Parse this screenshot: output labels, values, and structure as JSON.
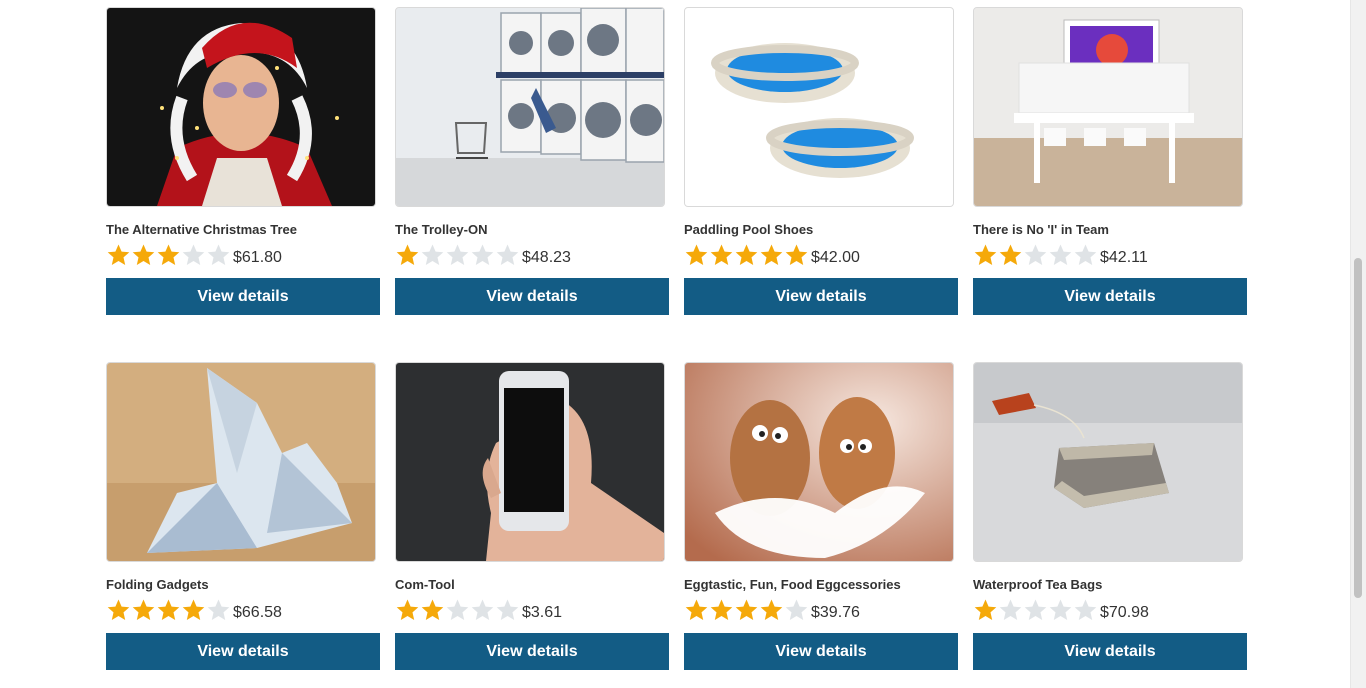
{
  "products": [
    {
      "name": "The Alternative Christmas Tree",
      "rating": 3,
      "price": "$61.80",
      "button": "View details",
      "image": "santa-lights-image"
    },
    {
      "name": "The Trolley-ON",
      "rating": 1,
      "price": "$48.23",
      "button": "View details",
      "image": "laundromat-image"
    },
    {
      "name": "Paddling Pool Shoes",
      "rating": 5,
      "price": "$42.00",
      "button": "View details",
      "image": "paddling-pools-image"
    },
    {
      "name": "There is No 'I' in Team",
      "rating": 2,
      "price": "$42.11",
      "button": "View details",
      "image": "team-room-image"
    },
    {
      "name": "Folding Gadgets",
      "rating": 4,
      "price": "$66.58",
      "button": "View details",
      "image": "origami-note-image"
    },
    {
      "name": "Com-Tool",
      "rating": 2,
      "price": "$3.61",
      "button": "View details",
      "image": "smartphone-hand-image"
    },
    {
      "name": "Eggtastic, Fun, Food Eggcessories",
      "rating": 4,
      "price": "$39.76",
      "button": "View details",
      "image": "eggs-feathers-image"
    },
    {
      "name": "Waterproof Tea Bags",
      "rating": 1,
      "price": "$70.98",
      "button": "View details",
      "image": "tea-bag-image"
    }
  ],
  "rating_max": 5,
  "colors": {
    "button": "#135c85",
    "star_filled": "#f5a90a",
    "star_empty": "#dfe3e6"
  }
}
